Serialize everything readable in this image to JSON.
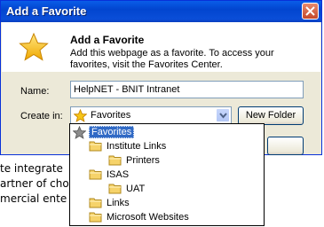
{
  "window": {
    "title": "Add a Favorite"
  },
  "header": {
    "heading": "Add a Favorite",
    "description": "Add this webpage as a favorite. To access your favorites, visit the Favorites Center."
  },
  "form": {
    "name_label": "Name:",
    "name_value": "HelpNET - BNIT Intranet",
    "createin_label": "Create in:",
    "createin_value": "Favorites",
    "new_folder_label": "New Folder"
  },
  "dropdown": {
    "items": [
      {
        "label": "Favorites",
        "icon": "star-icon",
        "selected": true
      },
      {
        "label": "Institute Links",
        "icon": "folder-icon"
      },
      {
        "label": "Printers",
        "icon": "folder-icon"
      },
      {
        "label": "ISAS",
        "icon": "folder-icon"
      },
      {
        "label": "UAT",
        "icon": "folder-icon"
      },
      {
        "label": "Links",
        "icon": "folder-icon"
      },
      {
        "label": "Microsoft Websites",
        "icon": "folder-icon"
      }
    ]
  },
  "background_page": {
    "lines": [
      "te integrate",
      "artner of cho",
      "mercial ente"
    ]
  },
  "colors": {
    "titlebar": "#0a5de8",
    "dialog_bg": "#ece9d8",
    "selection": "#316ac5",
    "close_button": "#d95b3c"
  }
}
